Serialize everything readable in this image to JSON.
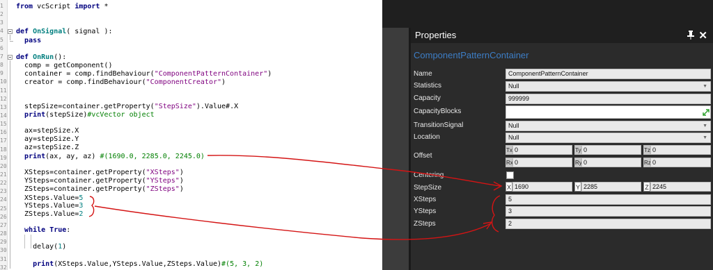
{
  "editor": {
    "line_numbers": [
      "1",
      "2",
      "3",
      "4",
      "5",
      "6",
      "7",
      "8",
      "9",
      "10",
      "11",
      "12",
      "13",
      "14",
      "15",
      "16",
      "17",
      "18",
      "19",
      "20",
      "21",
      "22",
      "23",
      "24",
      "25",
      "26",
      "27",
      "28",
      "29",
      "30",
      "31",
      "32"
    ],
    "lines": {
      "l1": [
        {
          "t": "from",
          "c": "kw"
        },
        {
          "t": " vcScript ",
          "c": ""
        },
        {
          "t": "import",
          "c": "kw"
        },
        {
          "t": " *",
          "c": ""
        }
      ],
      "l2": [
        {
          "t": "def",
          "c": "kw"
        },
        {
          "t": " ",
          "c": ""
        },
        {
          "t": "OnSignal",
          "c": "fn"
        },
        {
          "t": "( signal ):",
          "c": ""
        }
      ],
      "l3": [
        {
          "t": "  ",
          "c": ""
        },
        {
          "t": "pass",
          "c": "kw"
        }
      ],
      "l4": [
        {
          "t": "def",
          "c": "kw"
        },
        {
          "t": " ",
          "c": ""
        },
        {
          "t": "OnRun",
          "c": "fn"
        },
        {
          "t": "():",
          "c": ""
        }
      ],
      "l5": [
        {
          "t": "  comp = getComponent()",
          "c": ""
        }
      ],
      "l6": [
        {
          "t": "  container = comp.findBehaviour(",
          "c": ""
        },
        {
          "t": "\"ComponentPatternContainer\"",
          "c": "str"
        },
        {
          "t": ")",
          "c": ""
        }
      ],
      "l7": [
        {
          "t": "  creator = comp.findBehaviour(",
          "c": ""
        },
        {
          "t": "\"ComponentCreator\"",
          "c": "str"
        },
        {
          "t": ")",
          "c": ""
        }
      ],
      "l8": [
        {
          "t": "  stepSize=container.getProperty(",
          "c": ""
        },
        {
          "t": "\"StepSize\"",
          "c": "str"
        },
        {
          "t": ").Value#.X",
          "c": ""
        }
      ],
      "l9": [
        {
          "t": "  ",
          "c": ""
        },
        {
          "t": "print",
          "c": "kw"
        },
        {
          "t": "(stepSize)",
          "c": ""
        },
        {
          "t": "#vcVector object",
          "c": "cmt"
        }
      ],
      "l10": [
        {
          "t": "  ax=stepSize.X",
          "c": ""
        }
      ],
      "l11": [
        {
          "t": "  ay=stepSize.Y",
          "c": ""
        }
      ],
      "l12": [
        {
          "t": "  az=stepSize.Z",
          "c": ""
        }
      ],
      "l13": [
        {
          "t": "  ",
          "c": ""
        },
        {
          "t": "print",
          "c": "kw"
        },
        {
          "t": "(ax, ay, az) ",
          "c": ""
        },
        {
          "t": "#(1690.0, 2285.0, 2245.0)",
          "c": "cmt"
        }
      ],
      "l14": [
        {
          "t": "  XSteps=container.getProperty(",
          "c": ""
        },
        {
          "t": "\"XSteps\"",
          "c": "str"
        },
        {
          "t": ")",
          "c": ""
        }
      ],
      "l15": [
        {
          "t": "  YSteps=container.getProperty(",
          "c": ""
        },
        {
          "t": "\"YSteps\"",
          "c": "str"
        },
        {
          "t": ")",
          "c": ""
        }
      ],
      "l16": [
        {
          "t": "  ZSteps=container.getProperty(",
          "c": ""
        },
        {
          "t": "\"ZSteps\"",
          "c": "str"
        },
        {
          "t": ")",
          "c": ""
        }
      ],
      "l17": [
        {
          "t": "  XSteps.Value=",
          "c": ""
        },
        {
          "t": "5",
          "c": "num"
        }
      ],
      "l18": [
        {
          "t": "  YSteps.Value=",
          "c": ""
        },
        {
          "t": "3",
          "c": "num"
        }
      ],
      "l19": [
        {
          "t": "  ZSteps.Value=",
          "c": ""
        },
        {
          "t": "2",
          "c": "num"
        }
      ],
      "l20": [
        {
          "t": "  ",
          "c": ""
        },
        {
          "t": "while",
          "c": "kw"
        },
        {
          "t": " ",
          "c": ""
        },
        {
          "t": "True",
          "c": "kw"
        },
        {
          "t": ":",
          "c": ""
        }
      ],
      "l21": [
        {
          "t": "    delay(",
          "c": ""
        },
        {
          "t": "1",
          "c": "num"
        },
        {
          "t": ")",
          "c": ""
        }
      ],
      "l22": [
        {
          "t": "    ",
          "c": ""
        },
        {
          "t": "print",
          "c": "kw"
        },
        {
          "t": "(XSteps.Value,YSteps.Value,ZSteps.Value)",
          "c": ""
        },
        {
          "t": "#(5, 3, 2)",
          "c": "cmt"
        }
      ]
    }
  },
  "properties": {
    "title": "Properties",
    "pin_icon": "pin-icon",
    "close_label": "✕",
    "component_name": "ComponentPatternContainer",
    "labels": {
      "name": "Name",
      "statistics": "Statistics",
      "capacity": "Capacity",
      "capacity_blocks": "CapacityBlocks",
      "transition_signal": "TransitionSignal",
      "location": "Location",
      "offset": "Offset",
      "centering": "Centering",
      "step_size": "StepSize",
      "xsteps": "XSteps",
      "ysteps": "YSteps",
      "zsteps": "ZSteps"
    },
    "values": {
      "name": "ComponentPatternContainer",
      "statistics": "Null",
      "capacity": "999999",
      "capacity_blocks": "",
      "transition_signal": "Null",
      "location": "Null",
      "offset": {
        "tx_label": "Tx",
        "tx": "0",
        "ty_label": "Ty",
        "ty": "0",
        "tz_label": "Tz",
        "tz": "0",
        "rx_label": "Rx",
        "rx": "0",
        "ry_label": "Ry",
        "ry": "0",
        "rz_label": "Rz",
        "rz": "0"
      },
      "centering_checked": false,
      "step_size": {
        "x_label": "X",
        "x": "1690",
        "y_label": "Y",
        "y": "2285",
        "z_label": "Z",
        "z": "2245"
      },
      "xsteps": "5",
      "ysteps": "3",
      "zsteps": "2"
    },
    "dropdown_arrow": "▼"
  },
  "colors": {
    "annotation": "#d41414",
    "accent_blue": "#3d7ec6",
    "panel_bg": "#2b2b2b"
  }
}
